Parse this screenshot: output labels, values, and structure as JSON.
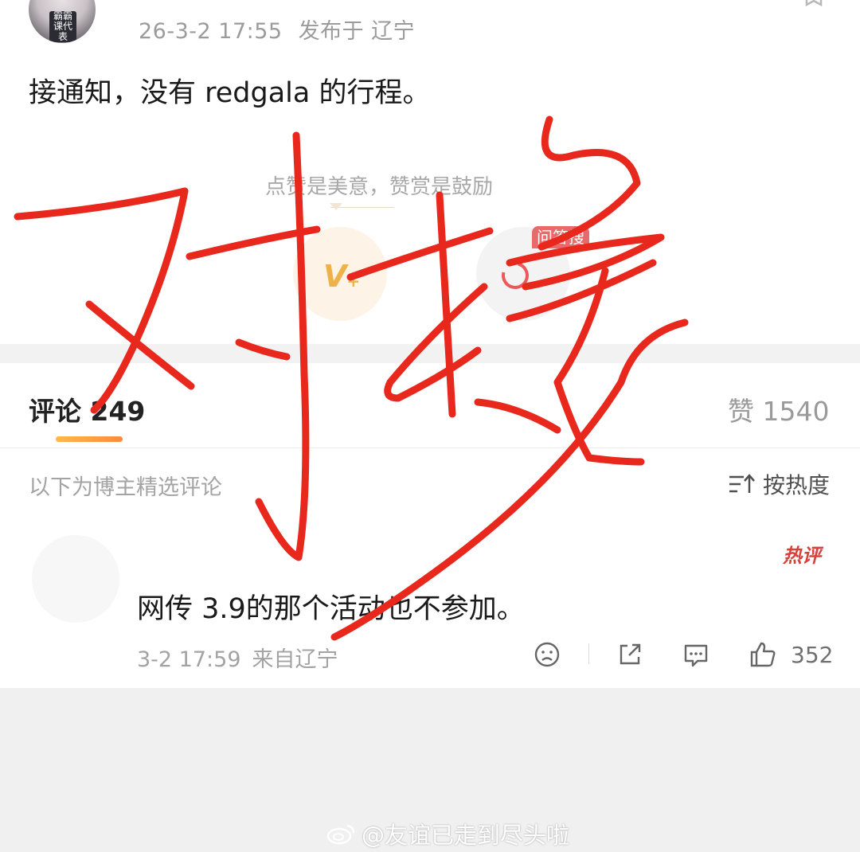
{
  "post": {
    "avatar_tag": "霸霸 课代表",
    "date": "26-3-2 17:55",
    "location": "发布于 辽宁",
    "text": "接通知，没有 redgala 的行程。"
  },
  "reward": {
    "caption": "点赞是美意，赞赏是鼓励",
    "vplus_label": "V",
    "ask_badge": "问答搜"
  },
  "comment_tabs": {
    "comments": "评论 249",
    "likes": "赞 1540"
  },
  "comment_list": {
    "curated_note": "以下为博主精选评论",
    "sort_label": "按热度"
  },
  "comment": {
    "hot_badge": "热评",
    "text": "网传 3.9的那个活动也不参加。",
    "time": "3-2 17:59",
    "source": "来自辽宁",
    "like_count": "352"
  },
  "watermark": {
    "text": "@友谊已走到尽头啦"
  },
  "annotation": {
    "handwriting": "对接",
    "color": "#e8281c"
  },
  "icons": {
    "bookmark": "bookmark-icon",
    "vplus": "vplus-icon",
    "ask": "ask-search-icon",
    "sort": "sort-icon",
    "dislike": "dislike-face-icon",
    "share": "share-icon",
    "reply": "reply-bubble-icon",
    "like": "thumbs-up-icon",
    "weibo": "weibo-logo-icon"
  },
  "colors": {
    "accent_orange": "#ff8a3a",
    "hot_red": "#d8413a",
    "muted_text": "#a3a3a3"
  }
}
